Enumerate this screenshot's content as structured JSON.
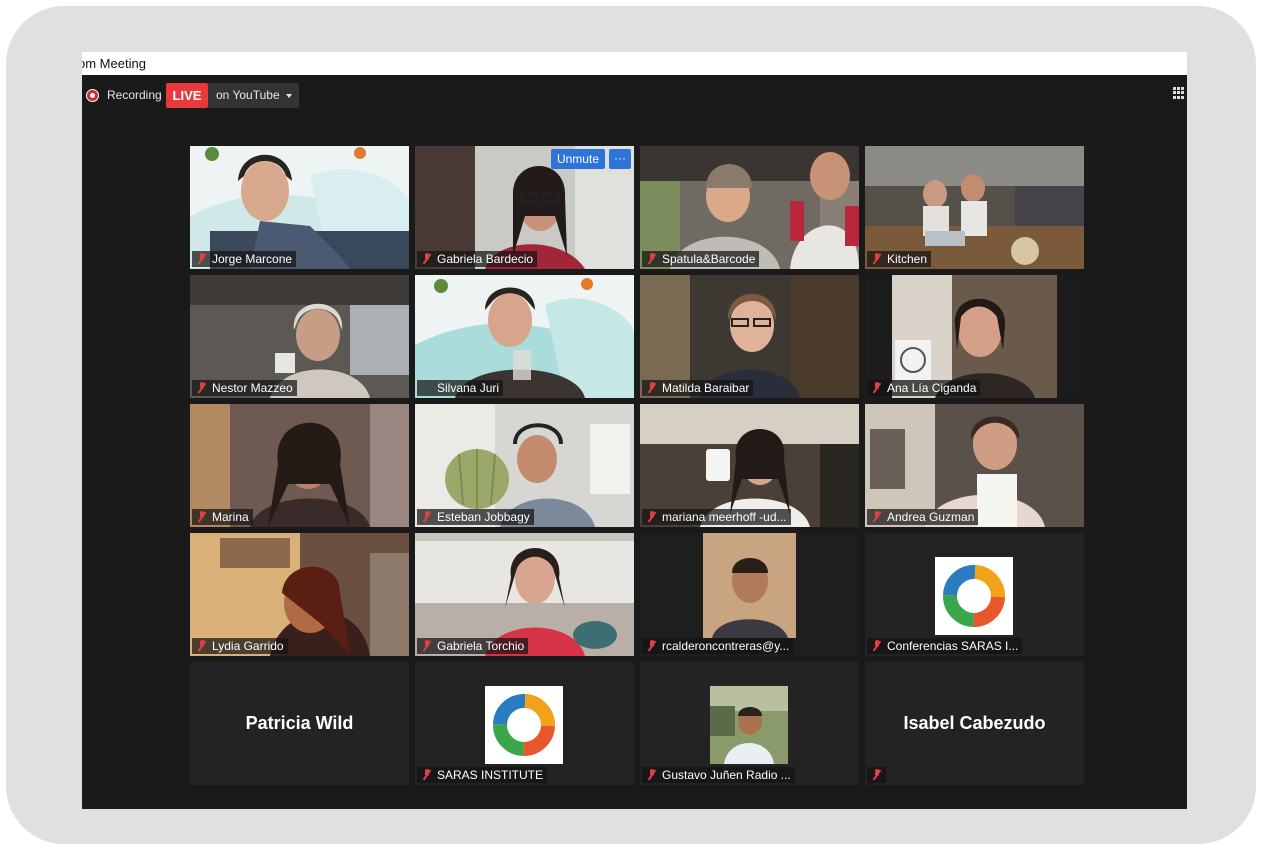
{
  "window": {
    "title": "om Meeting"
  },
  "toolbar": {
    "recording_label": "Recording",
    "live_label": "LIVE",
    "live_target": "on YouTube"
  },
  "colors": {
    "live_red": "#e83a3a",
    "active_speaker": "#d7e85a",
    "unmute_blue": "#2d73d8",
    "muted_mic": "#e04040"
  },
  "tiles": [
    {
      "name": "Jorge Marcone",
      "video": true
    },
    {
      "name": "Gabriela Bardecio",
      "video": true,
      "hover_buttons": {
        "unmute": "Unmute",
        "more": "···"
      }
    },
    {
      "name": "Spatula&Barcode",
      "video": true
    },
    {
      "name": "Kitchen",
      "video": true
    },
    {
      "name": "Nestor Mazzeo",
      "video": true
    },
    {
      "name": "Silvana Juri",
      "video": true,
      "active_speaker": true
    },
    {
      "name": "Matilda Baraibar",
      "video": true
    },
    {
      "name": "Ana Lía Ciganda",
      "video": true
    },
    {
      "name": "Marina",
      "video": true
    },
    {
      "name": "Esteban Jobbagy",
      "video": true
    },
    {
      "name": "mariana meerhoff -ud...",
      "video": true
    },
    {
      "name": "Andrea Guzman",
      "video": true
    },
    {
      "name": "Lydia Garrido",
      "video": true
    },
    {
      "name": "Gabriela Torchio",
      "video": true
    },
    {
      "name": "rcalderoncontreras@y...",
      "video": true
    },
    {
      "name": "Conferencias SARAS I...",
      "video": false,
      "avatar": "saras-logo"
    },
    {
      "name": "Patricia Wild",
      "video": false,
      "big_name": "Patricia Wild"
    },
    {
      "name": "SARAS INSTITUTE",
      "video": false,
      "avatar": "saras-logo"
    },
    {
      "name": "Gustavo Juñen Radio ...",
      "video": false,
      "avatar": "photo"
    },
    {
      "name": "",
      "video": false,
      "big_name": "Isabel Cabezudo"
    }
  ]
}
